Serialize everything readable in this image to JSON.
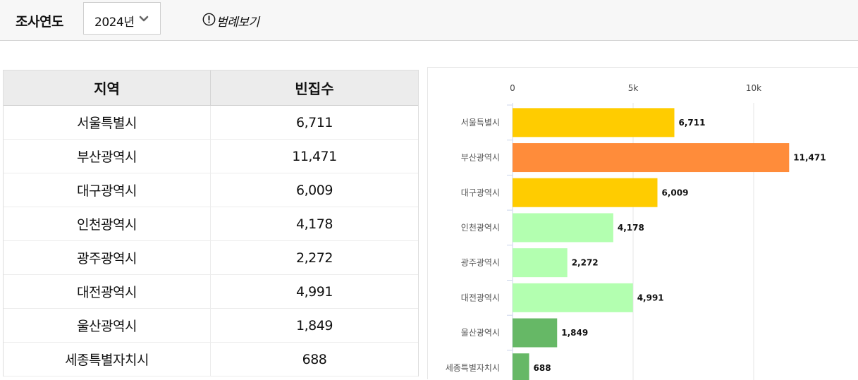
{
  "filter": {
    "year_label": "조사연도",
    "year_value": "2024년",
    "legend_button": "범례보기"
  },
  "table": {
    "headers": [
      "지역",
      "빈집수"
    ],
    "rows": [
      [
        "서울특별시",
        "6,711"
      ],
      [
        "부산광역시",
        "11,471"
      ],
      [
        "대구광역시",
        "6,009"
      ],
      [
        "인천광역시",
        "4,178"
      ],
      [
        "광주광역시",
        "2,272"
      ],
      [
        "대전광역시",
        "4,991"
      ],
      [
        "울산광역시",
        "1,849"
      ],
      [
        "세종특별자치시",
        "688"
      ]
    ]
  },
  "chart_data": {
    "type": "bar",
    "orientation": "horizontal",
    "categories": [
      "서울특별시",
      "부산광역시",
      "대구광역시",
      "인천광역시",
      "광주광역시",
      "대전광역시",
      "울산광역시",
      "세종특별자치시"
    ],
    "values": [
      6711,
      11471,
      6009,
      4178,
      2272,
      4991,
      1849,
      688
    ],
    "value_labels": [
      "6,711",
      "11,471",
      "6,009",
      "4,178",
      "2,272",
      "4,991",
      "1,849",
      "688"
    ],
    "bar_colors": [
      "#ffcc00",
      "#ff8c3a",
      "#ffcc00",
      "#b3ffb0",
      "#b3ffb0",
      "#b3ffb0",
      "#66b866",
      "#66b866"
    ],
    "xlim": [
      0,
      12000
    ],
    "xticks": [
      0,
      5000,
      10000
    ],
    "xtick_labels": [
      "0",
      "5k",
      "10k"
    ],
    "x_axis_position": "top",
    "grid": true
  }
}
